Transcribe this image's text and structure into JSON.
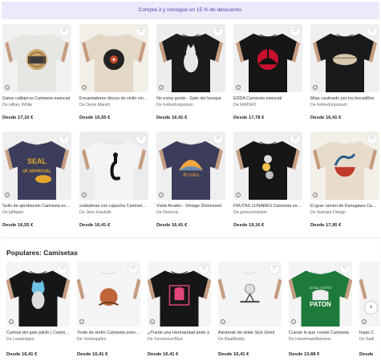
{
  "promo": {
    "text": "Compra 3 y consigue un 15 % de descuento."
  },
  "grid": [
    {
      "title": "Gatos callejeros Camiseta esencial",
      "artist": "De Hillary White",
      "price": "Desde 17,10 €",
      "shirt": "#e6e6e3",
      "bg": "#f1f1ef",
      "print": "cats-emblem"
    },
    {
      "title": "Encantadores discos de vinilo vintage",
      "artist": "De Denis Marsili",
      "price": "Desde 16,55 €",
      "shirt": "#e3d8c6",
      "bg": "#f2eee8",
      "print": "vinyl"
    },
    {
      "title": "No estoy gordo - Gato del bosque",
      "artist": "De FelineEmporium",
      "price": "Desde 16,41 €",
      "shirt": "#1b1b1b",
      "bg": "#ededed",
      "print": "cat-white"
    },
    {
      "title": "EDDA Camiseta esencial",
      "artist": "De RAIDHO",
      "price": "Desde 17,78 €",
      "shirt": "#161616",
      "bg": "#efefef",
      "print": "red-circle"
    },
    {
      "title": "Miau cautivado por los bocadillos",
      "artist": "De FelineEmporium",
      "price": "Desde 16,41 €",
      "shirt": "#1a1a1a",
      "bg": "#efefef",
      "print": "cat-loaf"
    },
    {
      "title": "Sello de aprobación Camiseta esencial",
      "artist": "De jaffajam",
      "price": "Desde 16,55 €",
      "shirt": "#3b3d5a",
      "bg": "#efefef",
      "print": "seal"
    },
    {
      "title": "sudaderas con capucha Camiseta esencial",
      "artist": "De Jenn Inashvili",
      "price": "Desde 16,41 €",
      "shirt": "#f4f4f4",
      "bg": "#ececec",
      "print": "black-cat"
    },
    {
      "title": "Visita Arrakis - Vintage Distressed",
      "artist": "De Nemons",
      "price": "Desde 16,41 €",
      "shirt": "#3b3d5a",
      "bg": "#efefef",
      "print": "arrakis"
    },
    {
      "title": "FRUTAS LUNARES Camiseta esencial",
      "artist": "De jamesormiston",
      "price": "Desde 19,16 €",
      "shirt": "#161616",
      "bg": "#efefef",
      "print": "moons"
    },
    {
      "title": "El gran ramen de Kanagawa Camiseta",
      "artist": "De Ilustrata Design",
      "price": "Desde 17,95 €",
      "shirt": "#e7dccb",
      "bg": "#f3efe9",
      "print": "ramen"
    }
  ],
  "popular": {
    "heading": "Populares: Camisetas",
    "items": [
      {
        "title": "Camisa del gato pitufo | Camiseta",
        "artist": "De Leadesigns",
        "price": "Desde 16,41 €",
        "shirt": "#161616",
        "bg": "#f4f4f4",
        "print": "blue-cat"
      },
      {
        "title": "Tonte de otoño Camiseta esencial",
        "artist": "De Violetapples",
        "price": "Desde 16,41 €",
        "shirt": "#f4f4f4",
        "bg": "#f4f4f4",
        "print": "autumn"
      },
      {
        "title": "¿Puede una Hermandad pedir a",
        "artist": "De SummonerBlue",
        "price": "Desde 16,41 €",
        "shirt": "#161616",
        "bg": "#f4f4f4",
        "print": "pink"
      },
      {
        "title": "Asistente de skate Sick Grind",
        "artist": "De BaalBuddy",
        "price": "Desde 16,41 €",
        "shirt": "#f4f4f4",
        "bg": "#f4f4f4",
        "print": "skate"
      },
      {
        "title": "Cueste lo que cueste Camiseta",
        "artist": "De HandmadeBanners",
        "price": "Desde 13,68 €",
        "shirt": "#1e7a3a",
        "bg": "#f4f4f4",
        "print": "paton"
      },
      {
        "title": "hojas C",
        "artist": "De Sadi",
        "price": "Desde",
        "shirt": "#f4f4f4",
        "bg": "#f4f4f4",
        "print": "leaves"
      }
    ],
    "paton_top": "AT ALL COSTS",
    "paton_name": "PATON"
  },
  "print_text": {
    "seal": "SEAL OF APPROVAL",
    "arrakis": "Arrakis"
  },
  "icons": {
    "heart": "heart-icon",
    "info": "info-icon",
    "next": "chevron-right-icon"
  }
}
